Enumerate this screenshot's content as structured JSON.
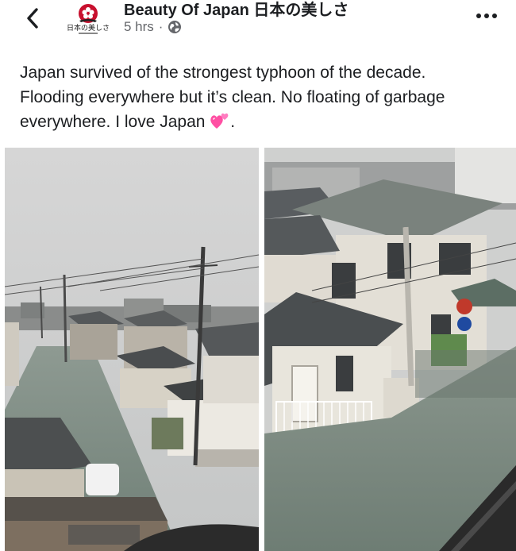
{
  "header": {
    "page_name": "Beauty Of Japan 日本の美しさ",
    "time": "5 hrs",
    "separator": "·",
    "avatar_caption": "日本の美しさ"
  },
  "post": {
    "text_line1": "Japan survived of the strongest typhoon of the decade.",
    "text_line2": "Flooding everywhere but it’s clean. No floating of garbage",
    "text_line3": "everywhere. I love Japan ",
    "text_end": ".",
    "emoji": "two-hearts-emoji"
  },
  "photos": [
    {
      "name": "flooded-street-photo"
    },
    {
      "name": "flooded-house-photo"
    }
  ],
  "colors": {
    "text": "#1c1e21",
    "meta": "#65676b",
    "flood_water": "#7f8f86",
    "sky": "#cfd0d0"
  }
}
